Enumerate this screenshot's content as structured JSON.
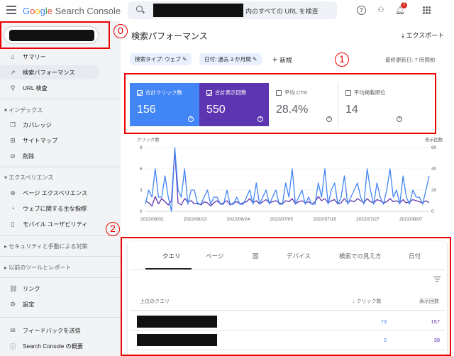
{
  "header": {
    "logo_google": "Google",
    "logo_product": "Search Console",
    "search_placeholder_suffix": "内のすべての URL を検査",
    "notification_count": "7"
  },
  "sidebar": {
    "items": [
      {
        "icon": "home-icon",
        "glyph": "⌂",
        "label": "サマリー"
      },
      {
        "icon": "trending-up-icon",
        "glyph": "↗",
        "label": "検索パフォーマンス",
        "active": true
      },
      {
        "icon": "search-icon",
        "glyph": "⚲",
        "label": "URL 検査"
      }
    ],
    "section_index": "インデックス",
    "index_items": [
      {
        "icon": "file-copy-icon",
        "glyph": "❐",
        "label": "カバレッジ"
      },
      {
        "icon": "sitemap-icon",
        "glyph": "⊞",
        "label": "サイトマップ"
      },
      {
        "icon": "visibility-off-icon",
        "glyph": "⊘",
        "label": "削除"
      }
    ],
    "section_experience": "エクスペリエンス",
    "experience_items": [
      {
        "icon": "add-circle-icon",
        "glyph": "⊕",
        "label": "ページ エクスペリエンス"
      },
      {
        "icon": "speed-icon",
        "glyph": "◔",
        "label": "ウェブに関する主な指標"
      },
      {
        "icon": "smartphone-icon",
        "glyph": "▯",
        "label": "モバイル ユーザビリティ"
      }
    ],
    "section_security": "セキュリティと手動による対策",
    "section_legacy": "以前のツールとレポート",
    "misc_items": [
      {
        "icon": "link-icon",
        "glyph": "⛓",
        "label": "リンク"
      },
      {
        "icon": "settings-icon",
        "glyph": "⚙",
        "label": "設定"
      }
    ],
    "footer_items": [
      {
        "icon": "feedback-icon",
        "glyph": "✉",
        "label": "フィードバックを送信"
      },
      {
        "icon": "info-icon",
        "glyph": "ⓘ",
        "label": "Search Console の概要"
      }
    ]
  },
  "annotations": [
    "0",
    "1",
    "2"
  ],
  "main": {
    "title": "検索パフォーマンス",
    "export_label": "エクスポート",
    "chips": [
      "検索タイプ: ウェブ",
      "日付: 過去 3 か月間"
    ],
    "new_label": "新規",
    "last_updated": "最終更新日: 7 時間前",
    "metrics": [
      {
        "label": "合計クリック数",
        "value": "156",
        "checked": true
      },
      {
        "label": "合計表示回数",
        "value": "550",
        "checked": true
      },
      {
        "label": "平均 CTR",
        "value": "28.4%",
        "checked": false
      },
      {
        "label": "平均掲載順位",
        "value": "14",
        "checked": false
      }
    ],
    "tabs": [
      "クエリ",
      "ページ",
      "国",
      "デバイス",
      "検索での見え方",
      "日付"
    ],
    "table": {
      "col_query": "上位のクエリ",
      "col_clicks": "クリック数",
      "col_impressions": "表示回数",
      "rows": [
        {
          "clicks": "73",
          "impressions": "157"
        },
        {
          "clicks": "0",
          "impressions": "38"
        }
      ]
    }
  },
  "chart_data": {
    "type": "line",
    "ylabel_left": "クリック数",
    "ylabel_right": "表示回数",
    "yticks_left": [
      "9",
      "6",
      "3",
      "0"
    ],
    "yticks_right": [
      "60",
      "40",
      "20",
      "0"
    ],
    "ylim_left": [
      0,
      9
    ],
    "ylim_right": [
      0,
      60
    ],
    "xticks": [
      "2022/06/02",
      "2022/06/13",
      "2022/06/24",
      "2022/07/05",
      "2022/07/16",
      "2022/07/27",
      "2022/08/07"
    ],
    "colors": {
      "clicks": "#4285f4",
      "impressions": "#5e35b1"
    },
    "series": [
      {
        "name": "クリック数",
        "axis": "left",
        "values": [
          1,
          3,
          2,
          6,
          2,
          2,
          5,
          2,
          0,
          9,
          3,
          2,
          6,
          1,
          3,
          3,
          1,
          1,
          2,
          3,
          1,
          2,
          2,
          1,
          1,
          3,
          1,
          1,
          2,
          1,
          1,
          2,
          3,
          1,
          4,
          1,
          2,
          3,
          1,
          2,
          3,
          1,
          1,
          4,
          2,
          6,
          1,
          2,
          3,
          1,
          2,
          1,
          1,
          4,
          2,
          6,
          1,
          3,
          4,
          1,
          2,
          5,
          1,
          2,
          3,
          4,
          2,
          1,
          6,
          3,
          1,
          4,
          2,
          1,
          3,
          6,
          2,
          3,
          1,
          5,
          2,
          1,
          3,
          2,
          2,
          1,
          3,
          5
        ]
      },
      {
        "name": "表示回数",
        "axis": "right",
        "values": [
          10,
          8,
          5,
          14,
          7,
          12,
          9,
          6,
          10,
          58,
          8,
          6,
          12,
          9,
          10,
          7,
          8,
          6,
          9,
          8,
          5,
          8,
          10,
          7,
          8,
          10,
          6,
          8,
          9,
          7,
          8,
          9,
          12,
          8,
          10,
          7,
          9,
          11,
          8,
          9,
          10,
          8,
          7,
          10,
          9,
          12,
          7,
          9,
          10,
          8,
          9,
          7,
          9,
          14,
          10,
          12,
          8,
          10,
          11,
          7,
          8,
          12,
          8,
          10,
          9,
          12,
          10,
          8,
          12,
          9,
          8,
          11,
          10,
          8,
          9,
          12,
          9,
          10,
          8,
          11,
          8,
          9,
          11,
          10,
          9,
          8,
          10,
          8
        ]
      }
    ]
  }
}
